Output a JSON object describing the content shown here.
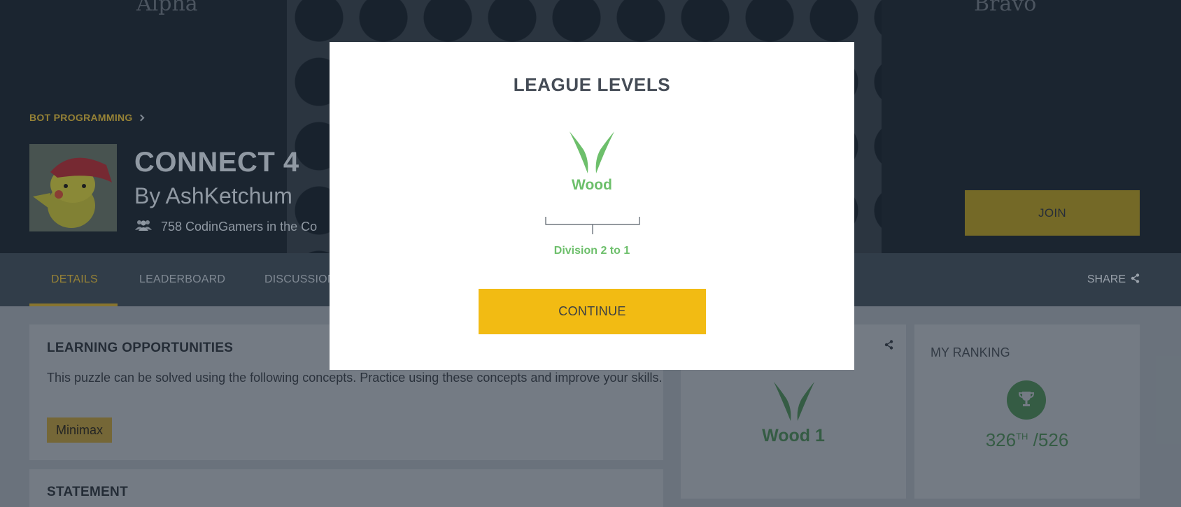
{
  "hero": {
    "player_left": "Alpha",
    "player_right": "Bravo",
    "breadcrumb": "BOT PROGRAMMING",
    "title": "CONNECT 4",
    "author": "By AshKetchum",
    "players_text": "758 CodinGamers in the Co",
    "join_label": "JOIN"
  },
  "tabs": [
    {
      "label": "DETAILS",
      "active": true
    },
    {
      "label": "LEADERBOARD",
      "active": false
    },
    {
      "label": "DISCUSSION",
      "active": false
    }
  ],
  "share_label": "SHARE",
  "learning": {
    "title": "LEARNING OPPORTUNITIES",
    "text": "This puzzle can be solved using the following concepts. Practice using these concepts and improve your skills.",
    "chips": [
      "Minimax"
    ]
  },
  "statement": {
    "title": "STATEMENT"
  },
  "league_card": {
    "value": "Wood 1"
  },
  "ranking": {
    "title": "MY RANKING",
    "rank": "326",
    "rank_suffix": "TH",
    "total": " /526"
  },
  "modal": {
    "title": "LEAGUE LEVELS",
    "league": "Wood",
    "division": "Division 2 to 1",
    "continue_label": "CONTINUE"
  },
  "colors": {
    "accent_yellow": "#f2bb13",
    "wood_green": "#6dbf6b",
    "hero_bg": "#2a3744"
  },
  "icons": [
    "chevron-right-icon",
    "users-icon",
    "share-icon",
    "wood-league-icon",
    "trophy-icon"
  ]
}
